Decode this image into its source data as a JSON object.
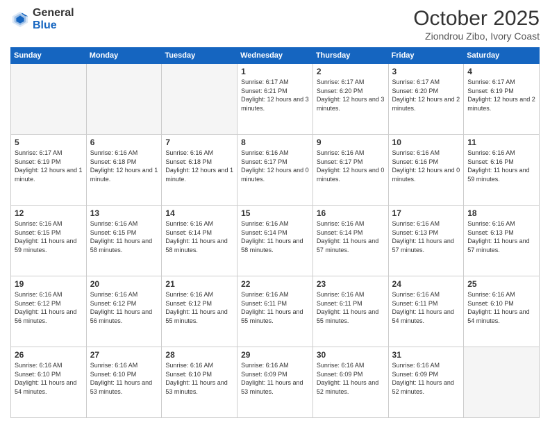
{
  "header": {
    "logo_general": "General",
    "logo_blue": "Blue",
    "month_title": "October 2025",
    "subtitle": "Ziondrou Zibo, Ivory Coast"
  },
  "days_of_week": [
    "Sunday",
    "Monday",
    "Tuesday",
    "Wednesday",
    "Thursday",
    "Friday",
    "Saturday"
  ],
  "weeks": [
    [
      {
        "num": "",
        "info": ""
      },
      {
        "num": "",
        "info": ""
      },
      {
        "num": "",
        "info": ""
      },
      {
        "num": "1",
        "info": "Sunrise: 6:17 AM\nSunset: 6:21 PM\nDaylight: 12 hours and 3 minutes."
      },
      {
        "num": "2",
        "info": "Sunrise: 6:17 AM\nSunset: 6:20 PM\nDaylight: 12 hours and 3 minutes."
      },
      {
        "num": "3",
        "info": "Sunrise: 6:17 AM\nSunset: 6:20 PM\nDaylight: 12 hours and 2 minutes."
      },
      {
        "num": "4",
        "info": "Sunrise: 6:17 AM\nSunset: 6:19 PM\nDaylight: 12 hours and 2 minutes."
      }
    ],
    [
      {
        "num": "5",
        "info": "Sunrise: 6:17 AM\nSunset: 6:19 PM\nDaylight: 12 hours and 1 minute."
      },
      {
        "num": "6",
        "info": "Sunrise: 6:16 AM\nSunset: 6:18 PM\nDaylight: 12 hours and 1 minute."
      },
      {
        "num": "7",
        "info": "Sunrise: 6:16 AM\nSunset: 6:18 PM\nDaylight: 12 hours and 1 minute."
      },
      {
        "num": "8",
        "info": "Sunrise: 6:16 AM\nSunset: 6:17 PM\nDaylight: 12 hours and 0 minutes."
      },
      {
        "num": "9",
        "info": "Sunrise: 6:16 AM\nSunset: 6:17 PM\nDaylight: 12 hours and 0 minutes."
      },
      {
        "num": "10",
        "info": "Sunrise: 6:16 AM\nSunset: 6:16 PM\nDaylight: 12 hours and 0 minutes."
      },
      {
        "num": "11",
        "info": "Sunrise: 6:16 AM\nSunset: 6:16 PM\nDaylight: 11 hours and 59 minutes."
      }
    ],
    [
      {
        "num": "12",
        "info": "Sunrise: 6:16 AM\nSunset: 6:15 PM\nDaylight: 11 hours and 59 minutes."
      },
      {
        "num": "13",
        "info": "Sunrise: 6:16 AM\nSunset: 6:15 PM\nDaylight: 11 hours and 58 minutes."
      },
      {
        "num": "14",
        "info": "Sunrise: 6:16 AM\nSunset: 6:14 PM\nDaylight: 11 hours and 58 minutes."
      },
      {
        "num": "15",
        "info": "Sunrise: 6:16 AM\nSunset: 6:14 PM\nDaylight: 11 hours and 58 minutes."
      },
      {
        "num": "16",
        "info": "Sunrise: 6:16 AM\nSunset: 6:14 PM\nDaylight: 11 hours and 57 minutes."
      },
      {
        "num": "17",
        "info": "Sunrise: 6:16 AM\nSunset: 6:13 PM\nDaylight: 11 hours and 57 minutes."
      },
      {
        "num": "18",
        "info": "Sunrise: 6:16 AM\nSunset: 6:13 PM\nDaylight: 11 hours and 57 minutes."
      }
    ],
    [
      {
        "num": "19",
        "info": "Sunrise: 6:16 AM\nSunset: 6:12 PM\nDaylight: 11 hours and 56 minutes."
      },
      {
        "num": "20",
        "info": "Sunrise: 6:16 AM\nSunset: 6:12 PM\nDaylight: 11 hours and 56 minutes."
      },
      {
        "num": "21",
        "info": "Sunrise: 6:16 AM\nSunset: 6:12 PM\nDaylight: 11 hours and 55 minutes."
      },
      {
        "num": "22",
        "info": "Sunrise: 6:16 AM\nSunset: 6:11 PM\nDaylight: 11 hours and 55 minutes."
      },
      {
        "num": "23",
        "info": "Sunrise: 6:16 AM\nSunset: 6:11 PM\nDaylight: 11 hours and 55 minutes."
      },
      {
        "num": "24",
        "info": "Sunrise: 6:16 AM\nSunset: 6:11 PM\nDaylight: 11 hours and 54 minutes."
      },
      {
        "num": "25",
        "info": "Sunrise: 6:16 AM\nSunset: 6:10 PM\nDaylight: 11 hours and 54 minutes."
      }
    ],
    [
      {
        "num": "26",
        "info": "Sunrise: 6:16 AM\nSunset: 6:10 PM\nDaylight: 11 hours and 54 minutes."
      },
      {
        "num": "27",
        "info": "Sunrise: 6:16 AM\nSunset: 6:10 PM\nDaylight: 11 hours and 53 minutes."
      },
      {
        "num": "28",
        "info": "Sunrise: 6:16 AM\nSunset: 6:10 PM\nDaylight: 11 hours and 53 minutes."
      },
      {
        "num": "29",
        "info": "Sunrise: 6:16 AM\nSunset: 6:09 PM\nDaylight: 11 hours and 53 minutes."
      },
      {
        "num": "30",
        "info": "Sunrise: 6:16 AM\nSunset: 6:09 PM\nDaylight: 11 hours and 52 minutes."
      },
      {
        "num": "31",
        "info": "Sunrise: 6:16 AM\nSunset: 6:09 PM\nDaylight: 11 hours and 52 minutes."
      },
      {
        "num": "",
        "info": ""
      }
    ]
  ]
}
